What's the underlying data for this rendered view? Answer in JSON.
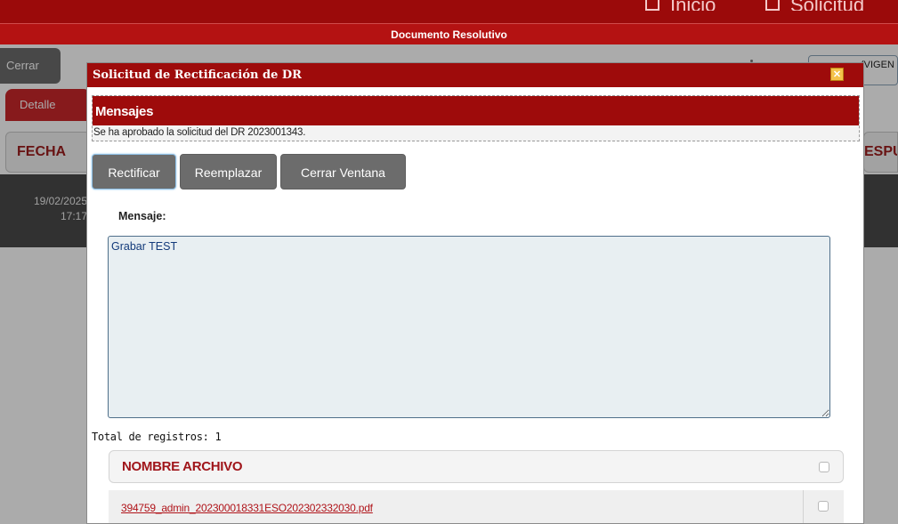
{
  "topnav": {
    "inicio_label": "Inicio",
    "solicitud_label": "Solicitud"
  },
  "page": {
    "header_title": "Documento Resolutivo",
    "cerrar_label": "Cerrar",
    "tab_detalle": "Detalle",
    "col_fecha": "FECHA",
    "date_value": "19/02/2025",
    "time_value": "17:17",
    "vigencia_text": "(VIGEN",
    "col_respuesta": "ESPU"
  },
  "dialog": {
    "title": "Solicitud de Rectificación de DR",
    "close_glyph": "✕",
    "messages": {
      "header": "Mensajes",
      "text": "Se ha aprobado la solicitud del DR 2023001343."
    },
    "buttons": {
      "rectificar": "Rectificar",
      "reemplazar": "Reemplazar",
      "cerrar_ventana": "Cerrar Ventana"
    },
    "mensaje_label": "Mensaje:",
    "mensaje_value": "Grabar TEST",
    "total_registros": "Total de registros: 1",
    "grid": {
      "header": "NOMBRE ARCHIVO",
      "rows": [
        {
          "filename": "394759_admin_202300018331ESO202302332030.pdf"
        }
      ]
    }
  },
  "colors": {
    "brand_red": "#9e0b0b",
    "header_red": "#b41212",
    "button_gray": "#6c6c6c",
    "link_red": "#b0141a"
  },
  "icons": {
    "inicio": "home-icon",
    "solicitud": "document-icon",
    "close": "close-icon"
  }
}
